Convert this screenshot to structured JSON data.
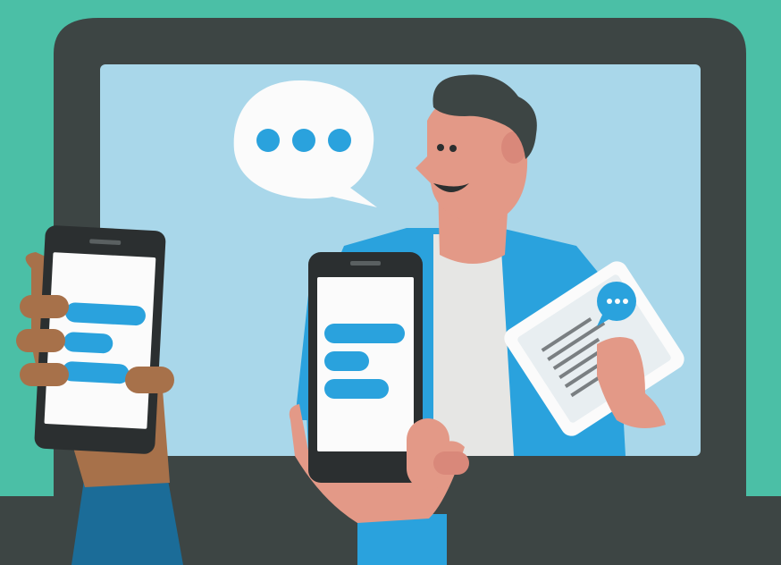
{
  "illustration": {
    "subject": "video-chat-with-smartphones",
    "icons": {
      "speech_bubble": "typing-dots-bubble-icon",
      "tablet_badge": "chat-bubble-icon"
    },
    "colors": {
      "background_teal": "#4bbfa6",
      "laptop_frame": "#3d4544",
      "screen_sky": "#a9d7ea",
      "bubble_white": "#fbfbfb",
      "accent_blue": "#2aa2dd",
      "skin_pink": "#e39987",
      "hair_dark": "#3d4544",
      "shirt_grey": "#e6e6e4",
      "skin_brown": "#a7714a",
      "sleeve_blue": "#1b6c98",
      "phone_black": "#2b2f30"
    },
    "left_phone": {
      "message_bars": 3
    },
    "center_phone": {
      "message_bars": 3
    },
    "tablet": {
      "text_lines": 6
    },
    "typing_dots": 3
  }
}
